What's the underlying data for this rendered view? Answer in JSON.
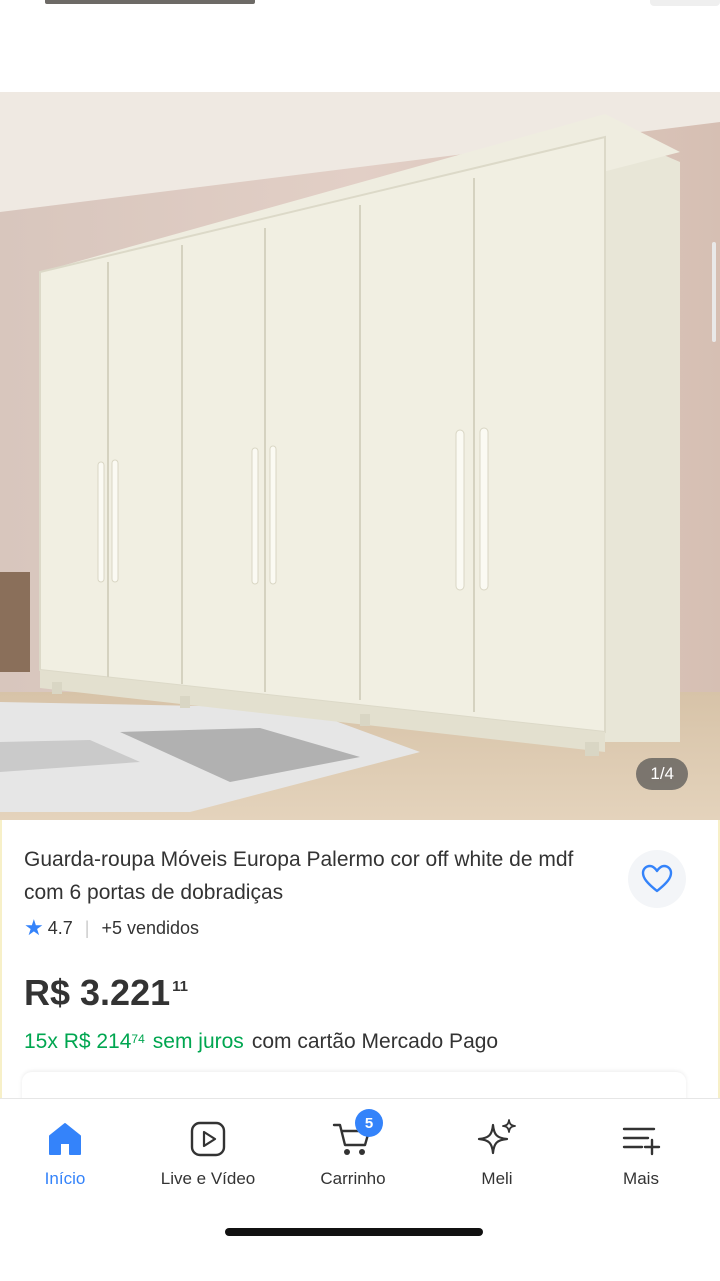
{
  "product": {
    "image_counter": "1/4",
    "title": "Guarda-roupa Móveis Europa Palermo cor off white de mdf com 6 portas de dobradiças",
    "rating": "4.7",
    "sold": "+5 vendidos",
    "price_main": "R$ 3.221",
    "price_cents": "11",
    "installments_prefix": "15x R$ 214",
    "installments_cents": "74",
    "installments_free": "sem juros",
    "installments_suffix": "com cartão Mercado Pago"
  },
  "nav": {
    "items": [
      {
        "label": "Início",
        "icon": "home-icon"
      },
      {
        "label": "Live e Vídeo",
        "icon": "play-icon"
      },
      {
        "label": "Carrinho",
        "icon": "cart-icon"
      },
      {
        "label": "Meli",
        "icon": "sparkle-icon"
      },
      {
        "label": "Mais",
        "icon": "menu-plus-icon"
      }
    ],
    "cart_badge": "5"
  },
  "colors": {
    "accent": "#3483fa",
    "green": "#00a650",
    "text": "#333333"
  }
}
